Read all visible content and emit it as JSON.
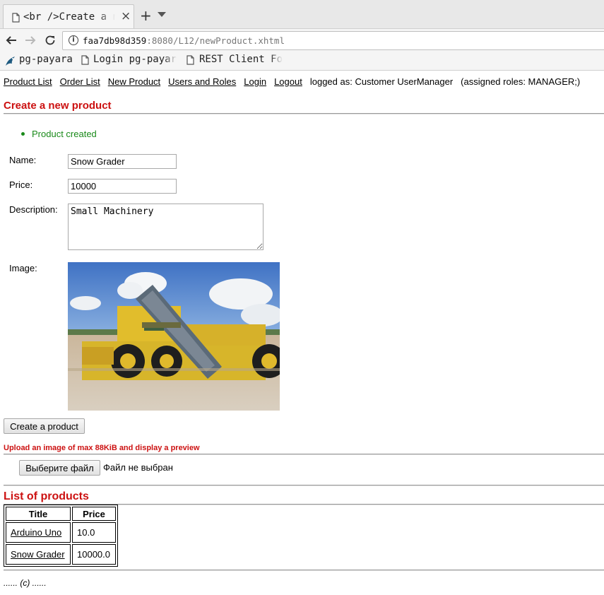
{
  "browser": {
    "tab_title": "<br />Create a new product",
    "close_glyph": "×",
    "new_tab_glyph": "+",
    "url_host": "faa7db98d359",
    "url_rest": ":8080/L12/newProduct.xhtml",
    "bookmarks": [
      "pg-payara",
      "Login pg-payara",
      "REST Client For"
    ]
  },
  "menu": {
    "links": [
      "Product List",
      "Order List",
      "New Product",
      "Users and Roles",
      "Login",
      "Logout"
    ],
    "logged_as": "logged as: Customer UserManager",
    "roles": "(assigned roles: MANAGER;)"
  },
  "form": {
    "heading": "Create a new product",
    "message": "Product created",
    "name_label": "Name:",
    "name_value": "Snow Grader",
    "price_label": "Price:",
    "price_value": "10000",
    "description_label": "Description:",
    "description_value": "Small Machinery",
    "image_label": "Image:",
    "submit_label": "Create a product"
  },
  "upload": {
    "title": "Upload an image of max 88KiB and display a preview",
    "choose_button": "Выберите файл",
    "no_file": "Файл не выбран"
  },
  "products": {
    "heading": "List of products",
    "columns": [
      "Title",
      "Price"
    ],
    "rows": [
      {
        "title": "Arduino Uno",
        "price": "10.0"
      },
      {
        "title": "Snow Grader",
        "price": "10000.0"
      }
    ]
  },
  "footer": {
    "text": "...... (c) ......"
  },
  "colors": {
    "heading_red": "#cc1111",
    "message_green": "#1a8a1a"
  }
}
